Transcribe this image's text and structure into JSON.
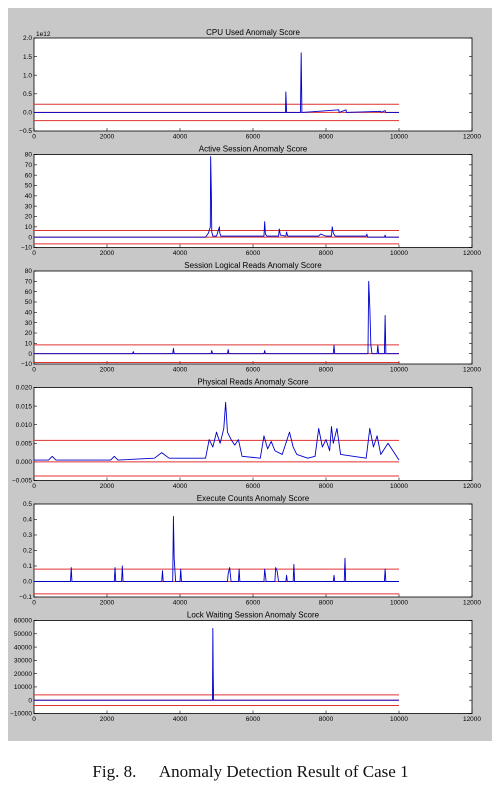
{
  "figure": {
    "caption_label": "Fig. 8.",
    "caption_text": "Anomaly Detection Result of Case 1"
  },
  "colors": {
    "signal": "#0000cc",
    "threshold": "#e03030",
    "panel_bg": "#c8c8c8"
  },
  "chart_data": [
    {
      "type": "line",
      "title": "CPU Used Anomaly Score",
      "scale_label": "1e12",
      "xlim": [
        0,
        12000
      ],
      "ylim": [
        -0.5,
        2.0
      ],
      "xticks": [
        0,
        2000,
        4000,
        6000,
        8000,
        10000,
        12000
      ],
      "yticks": [
        -0.5,
        0.0,
        0.5,
        1.0,
        1.5,
        2.0
      ],
      "ytick_labels": [
        "−0.5",
        "0.0",
        "0.5",
        "1.0",
        "1.5",
        "2.0"
      ],
      "thresholds": [
        0.22,
        0.0,
        -0.22
      ],
      "x": [
        0,
        5900,
        6890,
        6900,
        6910,
        6920,
        7300,
        7320,
        7330,
        7340,
        7360,
        8350,
        8360,
        8550,
        8560,
        9500,
        9510,
        9620,
        9630,
        9640,
        10000
      ],
      "y": [
        0.0,
        0.0,
        0.0,
        0.55,
        0.3,
        0.0,
        0.0,
        1.6,
        0.8,
        0.0,
        0.0,
        0.07,
        0.0,
        0.07,
        0.0,
        0.03,
        0.0,
        0.05,
        0.02,
        0.0,
        0.0
      ]
    },
    {
      "type": "line",
      "title": "Active Session Anomaly Score",
      "xlim": [
        0,
        12000
      ],
      "ylim": [
        -10,
        80
      ],
      "xticks": [
        0,
        2000,
        4000,
        6000,
        8000,
        10000,
        12000
      ],
      "yticks": [
        -10,
        0,
        10,
        20,
        30,
        40,
        50,
        60,
        70,
        80
      ],
      "ytick_labels": [
        "−10",
        "0",
        "10",
        "20",
        "30",
        "40",
        "50",
        "60",
        "70",
        "80"
      ],
      "thresholds": [
        6.5,
        0.0,
        -6.5
      ],
      "x": [
        0,
        4700,
        4780,
        4830,
        4840,
        4860,
        4870,
        4900,
        5000,
        5080,
        5090,
        5120,
        5200,
        6300,
        6320,
        6340,
        6380,
        6700,
        6720,
        6750,
        6900,
        6920,
        6950,
        7800,
        7850,
        8000,
        8150,
        8170,
        8200,
        8250,
        9100,
        9120,
        9140,
        9600,
        9620,
        9640,
        10000
      ],
      "y": [
        0,
        0,
        4,
        10,
        78,
        40,
        5,
        1,
        1,
        10,
        4,
        1,
        1,
        1,
        15,
        3,
        1,
        1,
        8,
        2,
        1,
        5,
        1,
        1,
        3,
        1,
        1,
        10,
        4,
        1,
        1,
        3,
        0,
        0,
        2,
        0,
        0
      ]
    },
    {
      "type": "line",
      "title": "Session Logical Reads Anomaly Score",
      "xlim": [
        0,
        12000
      ],
      "ylim": [
        -10,
        80
      ],
      "xticks": [
        0,
        2000,
        4000,
        6000,
        8000,
        10000,
        12000
      ],
      "yticks": [
        -10,
        0,
        10,
        20,
        30,
        40,
        50,
        60,
        70,
        80
      ],
      "ytick_labels": [
        "−10",
        "0",
        "10",
        "20",
        "30",
        "40",
        "50",
        "60",
        "70",
        "80"
      ],
      "thresholds": [
        8.5,
        0.0,
        -8.5
      ],
      "x": [
        0,
        2700,
        2720,
        2740,
        3800,
        3820,
        3840,
        4850,
        4870,
        4890,
        5300,
        5320,
        5340,
        6300,
        6320,
        6340,
        8200,
        8220,
        8240,
        9150,
        9170,
        9200,
        9230,
        9260,
        9400,
        9420,
        9440,
        9600,
        9620,
        9640,
        10000
      ],
      "y": [
        0,
        0,
        2,
        0,
        0,
        5,
        0,
        0,
        3,
        0,
        0,
        4,
        0,
        0,
        3,
        0,
        0,
        8,
        0,
        0,
        70,
        45,
        8,
        0,
        0,
        8,
        0,
        0,
        37,
        0,
        0
      ]
    },
    {
      "type": "line",
      "title": "Physical Reads Anomaly Score",
      "xlim": [
        0,
        12000
      ],
      "ylim": [
        -0.005,
        0.02
      ],
      "xticks": [
        0,
        2000,
        4000,
        6000,
        8000,
        10000,
        12000
      ],
      "yticks": [
        -0.005,
        0.0,
        0.005,
        0.01,
        0.015,
        0.02
      ],
      "ytick_labels": [
        "−0.005",
        "0.000",
        "0.005",
        "0.010",
        "0.015",
        "0.020"
      ],
      "thresholds": [
        0.0058,
        0.0,
        -0.0038
      ],
      "x": [
        0,
        400,
        500,
        600,
        1000,
        2100,
        2200,
        2300,
        3300,
        3500,
        3700,
        4700,
        4800,
        4900,
        5000,
        5100,
        5200,
        5250,
        5300,
        5400,
        5500,
        5600,
        5700,
        6200,
        6300,
        6400,
        6500,
        6600,
        6800,
        7000,
        7100,
        7200,
        7500,
        7700,
        7800,
        7900,
        8000,
        8100,
        8150,
        8200,
        8300,
        8400,
        9100,
        9200,
        9300,
        9400,
        9500,
        9700,
        10000
      ],
      "y": [
        0.0005,
        0.0005,
        0.0015,
        0.0005,
        0.0005,
        0.0005,
        0.0015,
        0.0005,
        0.001,
        0.0025,
        0.001,
        0.001,
        0.006,
        0.004,
        0.008,
        0.005,
        0.009,
        0.016,
        0.008,
        0.006,
        0.0045,
        0.006,
        0.0015,
        0.001,
        0.007,
        0.0035,
        0.0055,
        0.003,
        0.002,
        0.008,
        0.004,
        0.002,
        0.001,
        0.0015,
        0.009,
        0.004,
        0.006,
        0.003,
        0.0095,
        0.005,
        0.009,
        0.002,
        0.001,
        0.009,
        0.004,
        0.007,
        0.002,
        0.005,
        0.0005
      ]
    },
    {
      "type": "line",
      "title": "Execute Counts Anomaly Score",
      "xlim": [
        0,
        12000
      ],
      "ylim": [
        -0.1,
        0.5
      ],
      "xticks": [
        0,
        2000,
        4000,
        6000,
        8000,
        10000,
        12000
      ],
      "yticks": [
        -0.1,
        0.0,
        0.1,
        0.2,
        0.3,
        0.4,
        0.5
      ],
      "ytick_labels": [
        "−0.1",
        "0.0",
        "0.1",
        "0.2",
        "0.3",
        "0.4",
        "0.5"
      ],
      "thresholds": [
        0.08,
        0.0,
        -0.08
      ],
      "x": [
        0,
        1000,
        1020,
        1040,
        2200,
        2220,
        2240,
        2400,
        2420,
        2440,
        3500,
        3520,
        3540,
        3800,
        3820,
        3840,
        3880,
        4000,
        4020,
        4040,
        5300,
        5320,
        5360,
        5400,
        5600,
        5620,
        5640,
        6300,
        6320,
        6360,
        6600,
        6620,
        6660,
        6700,
        6900,
        6920,
        6940,
        7100,
        7120,
        7140,
        8200,
        8220,
        8240,
        8500,
        8520,
        8540,
        9600,
        9620,
        9640,
        10000
      ],
      "y": [
        0.0,
        0.0,
        0.09,
        0.0,
        0.0,
        0.09,
        0.0,
        0.0,
        0.1,
        0.0,
        0.0,
        0.07,
        0.0,
        0.0,
        0.42,
        0.15,
        0.0,
        0.0,
        0.08,
        0.0,
        0.0,
        0.05,
        0.09,
        0.0,
        0.0,
        0.08,
        0.0,
        0.0,
        0.08,
        0.0,
        0.0,
        0.09,
        0.07,
        0.0,
        0.0,
        0.04,
        0.0,
        0.0,
        0.11,
        0.0,
        0.0,
        0.04,
        0.0,
        0.0,
        0.15,
        0.0,
        0.0,
        0.08,
        0.0,
        0.0
      ]
    },
    {
      "type": "line",
      "title": "Lock Waiting Session Anomaly Score",
      "xlim": [
        0,
        12000
      ],
      "ylim": [
        -10000,
        60000
      ],
      "xticks": [
        0,
        2000,
        4000,
        6000,
        8000,
        10000,
        12000
      ],
      "yticks": [
        -10000,
        0,
        10000,
        20000,
        30000,
        40000,
        50000,
        60000
      ],
      "ytick_labels": [
        "−10000",
        "0",
        "10000",
        "20000",
        "30000",
        "40000",
        "50000",
        "60000"
      ],
      "thresholds": [
        4000,
        0,
        -4000
      ],
      "x": [
        0,
        4890,
        4900,
        4910,
        4920,
        10000
      ],
      "y": [
        0,
        0,
        54000,
        20000,
        0,
        0
      ]
    }
  ]
}
